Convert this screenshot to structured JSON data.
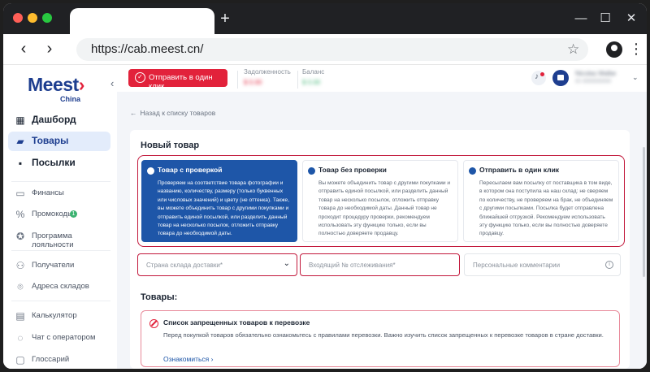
{
  "browser": {
    "url": "https://cab.meest.cn/",
    "new_tab_glyph": "+",
    "controls": {
      "minimize": "—",
      "maximize": "☐",
      "close": "✕"
    },
    "nav": {
      "back": "‹",
      "forward": "›"
    },
    "colors": {
      "close": "#ff5f57",
      "minimize": "#febc2e",
      "maximize": "#28c840"
    }
  },
  "sidebar": {
    "logo": {
      "main": "Meest",
      "sub": "China"
    },
    "collapse_glyph": "‹",
    "items": [
      {
        "label": "Дашборд",
        "icon": "dashboard-icon",
        "glyph": "▦"
      },
      {
        "label": "Товары",
        "icon": "shopping-bag-icon",
        "glyph": "▰"
      },
      {
        "label": "Посылки",
        "icon": "package-icon",
        "glyph": "▪"
      },
      {
        "label": "Финансы",
        "icon": "wallet-icon",
        "glyph": "▭"
      },
      {
        "label": "Промокоды",
        "icon": "promo-icon",
        "glyph": "%",
        "badge": "1"
      },
      {
        "label": "Программа лояльности",
        "icon": "star-icon",
        "glyph": "✪"
      },
      {
        "label": "Получатели",
        "icon": "users-icon",
        "glyph": "⚇"
      },
      {
        "label": "Адреса складов",
        "icon": "location-pin-icon",
        "glyph": "⌾"
      },
      {
        "label": "Калькулятор",
        "icon": "calculator-icon",
        "glyph": "▤"
      },
      {
        "label": "Чат с оператором",
        "icon": "chat-icon",
        "glyph": "◌"
      },
      {
        "label": "Глоссарий",
        "icon": "glossary-icon",
        "glyph": "▢"
      }
    ]
  },
  "header": {
    "send_button": "Отправить в один клик",
    "debt": {
      "label": "Задолженность",
      "value": "$ 0.00"
    },
    "balance": {
      "label": "Баланс",
      "value": "$ 0.00"
    },
    "user": {
      "name": "Nicolas Malbe",
      "sub": "ID 000000000"
    }
  },
  "main": {
    "back_link": "Назад к списку товаров",
    "card_title": "Новый товар",
    "options": [
      {
        "title": "Товар с проверкой",
        "desc": "Проверяем на соответствие товара фотографии и названию, количеству, размеру (только буквенных или числовых значений) и цвету (не оттенка). Также, вы можете объединить товар с другими покупками и отправить единой посылкой, или разделить данный товар на несколько посылок, отложить отправку товара до необходимой даты.",
        "selected": true
      },
      {
        "title": "Товар без проверки",
        "desc": "Вы можете объединить товар с другими покупками и отправить единой посылкой, или разделить данный товар на несколько посылок, отложить отправку товара до необходимой даты. Данный товар не проходит процедуру проверки, рекомендуем использовать эту функцию только, если вы полностью доверяете продавцу.",
        "selected": false
      },
      {
        "title": "Отправить в один клик",
        "desc": "Пересылаем вам посылку от поставщика в том виде, в котором она поступила на наш склад: не сверяем по количеству, не проверяем на брак, не объединяем с другими посылками. Посылка будет отправлена ближайшей отгрузкой. Рекомендуем использовать эту функцию только, если вы полностью доверяете продавцу.",
        "selected": false
      }
    ],
    "fields": {
      "country": "Страна склада доставки*",
      "tracking": "Входящий № отслеживания*",
      "comment": "Персональные комментарии"
    },
    "goods_title": "Товары:",
    "notice": {
      "title": "Список запрещенных товаров к перевозке",
      "desc": "Перед покупкой товаров обязательно ознакомьтесь с правилами перевозки. Важно изучить список запрещенных к перевозке товаров в стране доставки.",
      "link": "Ознакомиться"
    }
  },
  "colors": {
    "brand_red": "#e2223b",
    "brand_blue": "#1e3e8f",
    "selected_blue": "#1e56a8",
    "highlight": "#c2183b"
  }
}
